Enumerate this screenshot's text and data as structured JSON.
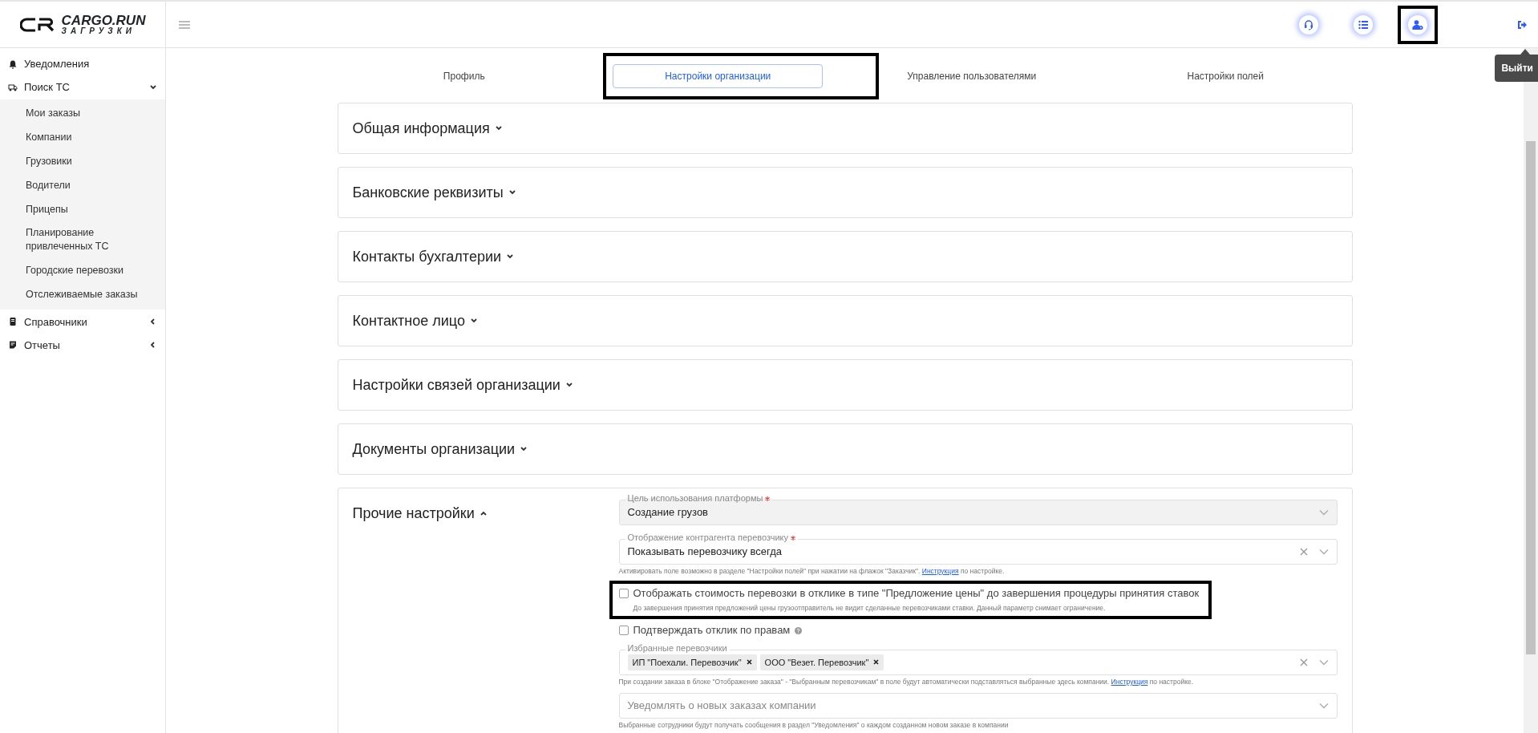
{
  "logo": {
    "brand": "CARGO.RUN",
    "subtitle": "ЗАГРУЗКИ"
  },
  "sidebar": {
    "items": [
      {
        "label": "Уведомления"
      },
      {
        "label": "Поиск ТС",
        "expanded": true,
        "children": [
          {
            "label": "Мои заказы"
          },
          {
            "label": "Компании"
          },
          {
            "label": "Грузовики"
          },
          {
            "label": "Водители"
          },
          {
            "label": "Прицепы"
          },
          {
            "label": "Планирование привлеченных ТС"
          },
          {
            "label": "Городские перевозки"
          },
          {
            "label": "Отслеживаемые заказы"
          }
        ]
      },
      {
        "label": "Справочники",
        "expanded": false
      },
      {
        "label": "Отчеты",
        "expanded": false
      }
    ]
  },
  "topbar": {
    "icon_buttons": [
      {
        "highlighted": false
      },
      {
        "highlighted": false
      },
      {
        "highlighted": true
      }
    ],
    "tooltip": "Выйти"
  },
  "tabs": [
    {
      "label": "Профиль",
      "selected": false,
      "highlighted": false
    },
    {
      "label": "Настройки организации",
      "selected": true,
      "highlighted": true
    },
    {
      "label": "Управление пользователями",
      "selected": false,
      "highlighted": false
    },
    {
      "label": "Настройки полей",
      "selected": false,
      "highlighted": false
    }
  ],
  "sections": [
    {
      "title": "Общая информация",
      "expanded": false
    },
    {
      "title": "Банковские реквизиты",
      "expanded": false
    },
    {
      "title": "Контакты бухгалтерии",
      "expanded": false
    },
    {
      "title": "Контактное лицо",
      "expanded": false
    },
    {
      "title": "Настройки связей организации",
      "expanded": false
    },
    {
      "title": "Документы организации",
      "expanded": false
    },
    {
      "title": "Прочие настройки",
      "expanded": true,
      "fields": [
        {
          "kind": "select",
          "label": "Цель использования платформы",
          "required": true,
          "value": "Создание грузов",
          "disabled": true,
          "clearable": false
        },
        {
          "kind": "select",
          "label": "Отображение контрагента перевозчику",
          "required": true,
          "value": "Показывать перевозчику всегда",
          "disabled": false,
          "clearable": true,
          "help": {
            "before": "Активировать поле возможно в разделе \"Настройки полей\" при нажатии на флажок \"Заказчик\".",
            "link": "Инструкция",
            "after": "по настройке."
          }
        },
        {
          "kind": "checkbox",
          "label": "Отображать стоимость перевозки в отклике в типе \"Предложение цены\" до завершения процедуры принятия ставок",
          "checked": false,
          "highlighted": true,
          "note": "До завершения принятия предложений цены грузоотправитель не видит сделанные перевозчиками ставки. Данный параметр снимает ограничение."
        },
        {
          "kind": "checkbox",
          "label": "Подтверждать отклик по правам",
          "checked": false,
          "highlighted": false,
          "info": true
        },
        {
          "kind": "multiselect",
          "label": "Избранные перевозчики",
          "tags": [
            "ИП \"Поехали. Перевозчик\"",
            "ООО \"Везет. Перевозчик\""
          ],
          "clearable": true,
          "help": {
            "before": "При создании заказа в блоке \"Отображение заказа\" - \"Выбранным перевозчикам\" в поле будут автоматически подставляться выбранные здесь компании.",
            "link": "Инструкция",
            "after": "по настройке."
          }
        },
        {
          "kind": "select",
          "placeholder": "Уведомлять о новых заказах компании",
          "disabled": false,
          "clearable": false,
          "help": {
            "before": "Выбранные сотрудники будут получать сообщения в раздел \"Уведомления\" о каждом созданном новом заказе в компании"
          }
        }
      ]
    }
  ]
}
